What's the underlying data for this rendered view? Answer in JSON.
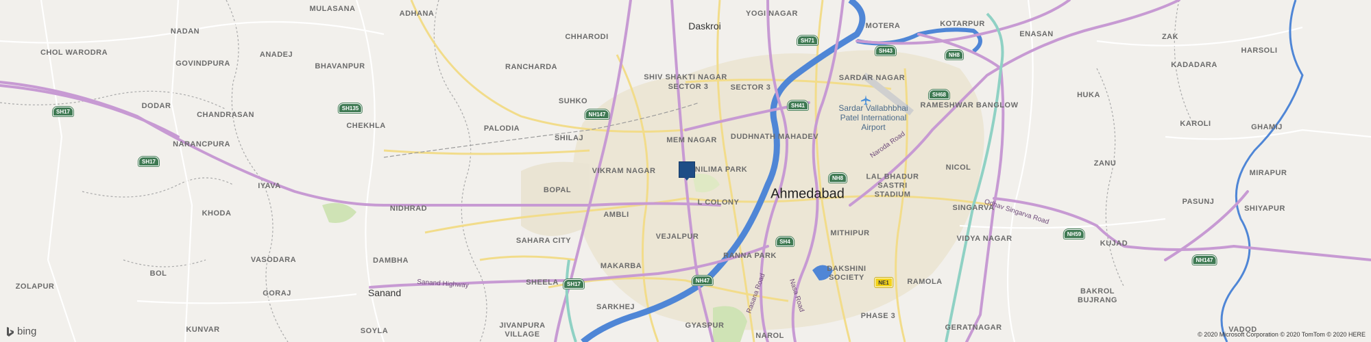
{
  "map": {
    "provider_logo": "bing",
    "copyright": "© 2020 Microsoft Corporation © 2020 TomTom © 2020 HERE",
    "pin_icon": "square-location-marker",
    "colors": {
      "background": "#f2f0ec",
      "river": "#4f86d6",
      "highway": "#c79ad3",
      "arterial": "#f2dc8a",
      "urban": "#ece6d5",
      "park": "#cfe3b5",
      "pin": "#1e4d86",
      "shield_green": "#3f7a53",
      "shield_yellow": "#f2d21a"
    },
    "labels": {
      "mulasana": "MULASANA",
      "adhana": "ADHANA",
      "daskroi": "Daskroi",
      "yogi_nagar": "YOGI NAGAR",
      "motera": "MOTERA",
      "kotarpur": "KOTARPUR",
      "nadan": "NADAN",
      "chharodi": "CHHARODI",
      "enasan": "ENASAN",
      "zak": "ZAK",
      "harsoli": "HARSOLI",
      "chol_warodra": "CHOL WARODRA",
      "anadej": "ANADEJ",
      "govindpura": "GOVINDPURA",
      "bhavanpur": "BHAVANPUR",
      "rancharda": "RANCHARDA",
      "shiv_shakti_nagar": "SHIV SHAKTI NAGAR",
      "sector_3a": "SECTOR 3",
      "sector_3b": "SECTOR 3",
      "sardar_nagar": "SARDAR NAGAR",
      "kadadara": "KADADARA",
      "dodar": "DODAR",
      "suhko": "SUHKO",
      "rameshwar_banglow": "RAMESHWAR BANGLOW",
      "huka": "HUKA",
      "chandrasan": "CHANDRASAN",
      "chekhla": "CHEKHLA",
      "palodia": "PALODIA",
      "mem_nagar": "MEM NAGAR",
      "dudhnath_mahadev": "DUDHNATH MAHADEV",
      "karoli": "KAROLI",
      "ghamij": "GHAMIJ",
      "narancpura": "NARANCPURA",
      "shilaj": "SHILAJ",
      "nilima_park": "NILIMA PARK",
      "zanu": "ZANU",
      "vikram_nagar": "VIKRAM NAGAR",
      "nicol": "NICOL",
      "mirapur": "MIRAPUR",
      "iyava": "IYAVA",
      "bopal": "BOPAL",
      "ahmedabad": "Ahmedabad",
      "lal_bhadur": "LAL BHADUR SASTRI STADIUM",
      "pasunj": "PASUNJ",
      "khoda": "KHODA",
      "nidhrad": "NIDHRAD",
      "ambli": "AMBLI",
      "l_colony": "L COLONY",
      "singarva": "SINGARVA",
      "shiyapur": "SHIYAPUR",
      "sahara_city": "SAHARA CITY",
      "vejalpur": "VEJALPUR",
      "mithipur": "MITHIPUR",
      "vidya_nagar": "VIDYA NAGAR",
      "kujad": "KUJAD",
      "vasodara": "VASODARA",
      "dambha": "DAMBHA",
      "makarba": "MAKARBA",
      "ranna_park": "RANNA PARK",
      "dakshini_society": "DAKSHINI SOCIETY",
      "zolapur": "ZOLAPUR",
      "bol": "BOL",
      "sheela": "SHEELA",
      "ramola": "RAMOLA",
      "bakrol_bujrang": "BAKROL BUJRANG",
      "sanand": "Sanand",
      "goraj": "GORAJ",
      "sarkhej": "SARKHEJ",
      "phase_3": "PHASE 3",
      "kunvar": "KUNVAR",
      "soyla": "SOYLA",
      "jivanpura_village": "JIVANPURA VILLAGE",
      "gyaspur": "GYASPUR",
      "narol": "NAROL",
      "geratnagar": "GERATNAGAR",
      "vadod": "VADOD",
      "airport": "Sardar Vallabhbhai Patel International Airport",
      "naroda_road": "Naroda Road",
      "odhav_road": "Odhav Singarva Road",
      "sanand_highway": "Sanand Highway",
      "rasana_road": "Rasana Road",
      "nasa_road": "Nasa Road"
    },
    "shields": {
      "sh71": "SH71",
      "sh43": "SH43",
      "nh8_top": "NH8",
      "sh17_a": "SH17",
      "sh135": "SH135",
      "nh147_a": "NH147",
      "sh41": "SH41",
      "sh68": "SH68",
      "sh17_b": "SH17",
      "nh8_mid": "NH8",
      "sh4": "SH4",
      "nh59": "NH59",
      "nh147_b": "NH147",
      "nh47": "NH47",
      "sh17_c": "SH17",
      "ne1": "NE1"
    }
  }
}
